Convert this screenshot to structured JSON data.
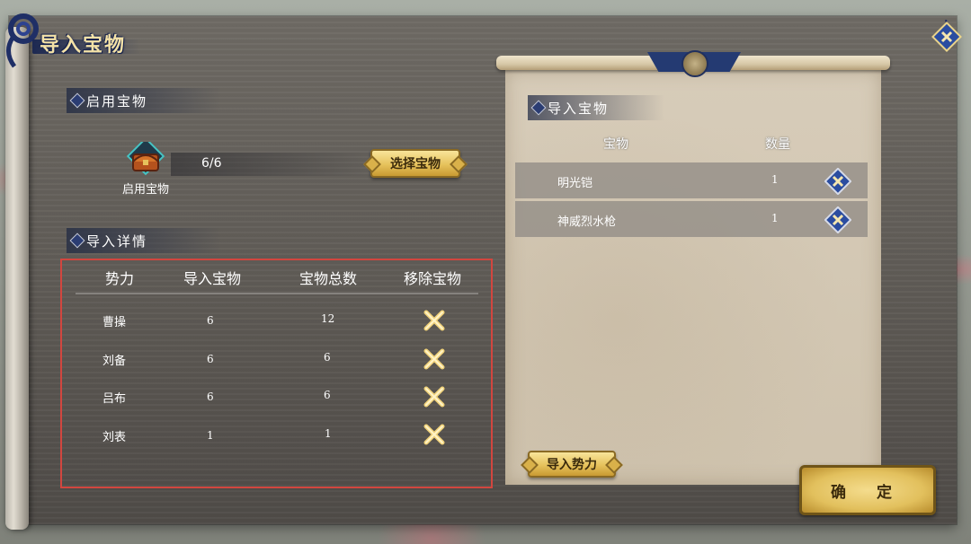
{
  "window": {
    "title": "导入宝物"
  },
  "enable_section": {
    "label": "启用宝物",
    "chest_label": "启用宝物",
    "count": "6/6",
    "select_button": "选择宝物"
  },
  "detail_section": {
    "label": "导入详情",
    "headers": [
      "势力",
      "导入宝物",
      "宝物总数",
      "移除宝物"
    ],
    "rows": [
      {
        "faction": "曹操",
        "imported": "6",
        "total": "12"
      },
      {
        "faction": "刘备",
        "imported": "6",
        "total": "6"
      },
      {
        "faction": "吕布",
        "imported": "6",
        "total": "6"
      },
      {
        "faction": "刘表",
        "imported": "1",
        "total": "1"
      }
    ]
  },
  "import_panel": {
    "label": "导入宝物",
    "col_item": "宝物",
    "col_qty": "数量",
    "items": [
      {
        "name": "明光铠",
        "qty": "1"
      },
      {
        "name": "神威烈水枪",
        "qty": "1"
      }
    ],
    "import_faction_button": "导入势力"
  },
  "confirm_button": "确 定",
  "colors": {
    "gold": "#e6c25c",
    "navy": "#243a72",
    "highlight_red": "#d2463f"
  },
  "icons": [
    "close-icon",
    "chest-icon",
    "remove-x-icon",
    "blue-remove-icon"
  ]
}
